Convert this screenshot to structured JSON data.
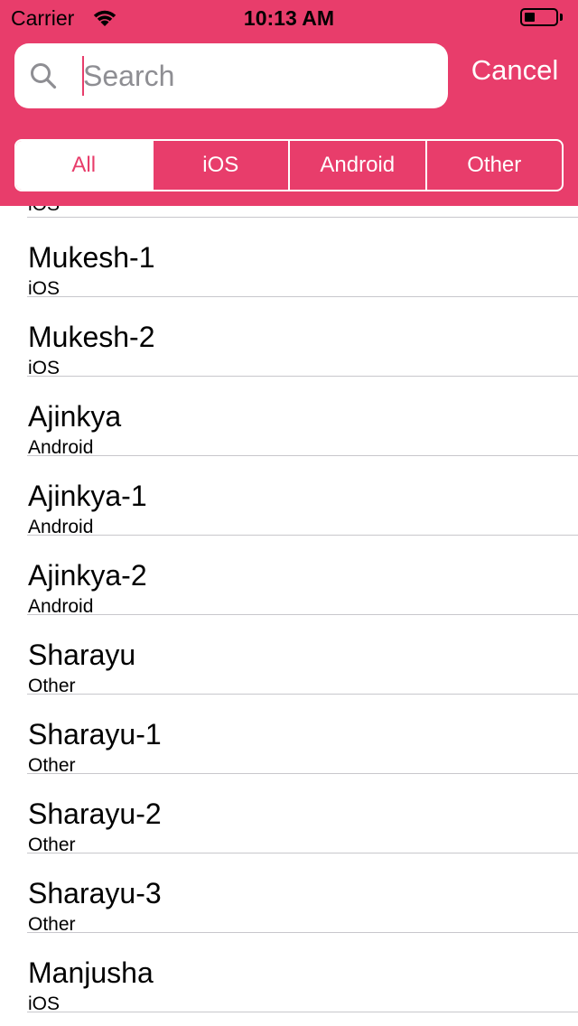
{
  "status_bar": {
    "carrier": "Carrier",
    "time": "10:13 AM",
    "battery_level": 0.35
  },
  "search": {
    "placeholder": "Search",
    "value": "",
    "cancel_label": "Cancel"
  },
  "scope": {
    "segments": [
      "All",
      "iOS",
      "Android",
      "Other"
    ],
    "selected": "All"
  },
  "colors": {
    "accent": "#e83d6b",
    "separator": "#c8c7cc"
  },
  "list": {
    "partial_row_subtitle": "iOS",
    "rows": [
      {
        "title": "Mukesh-1",
        "subtitle": "iOS"
      },
      {
        "title": "Mukesh-2",
        "subtitle": "iOS"
      },
      {
        "title": "Ajinkya",
        "subtitle": "Android"
      },
      {
        "title": "Ajinkya-1",
        "subtitle": "Android"
      },
      {
        "title": "Ajinkya-2",
        "subtitle": "Android"
      },
      {
        "title": "Sharayu",
        "subtitle": "Other"
      },
      {
        "title": "Sharayu-1",
        "subtitle": "Other"
      },
      {
        "title": "Sharayu-2",
        "subtitle": "Other"
      },
      {
        "title": "Sharayu-3",
        "subtitle": "Other"
      },
      {
        "title": "Manjusha",
        "subtitle": "iOS"
      }
    ]
  }
}
